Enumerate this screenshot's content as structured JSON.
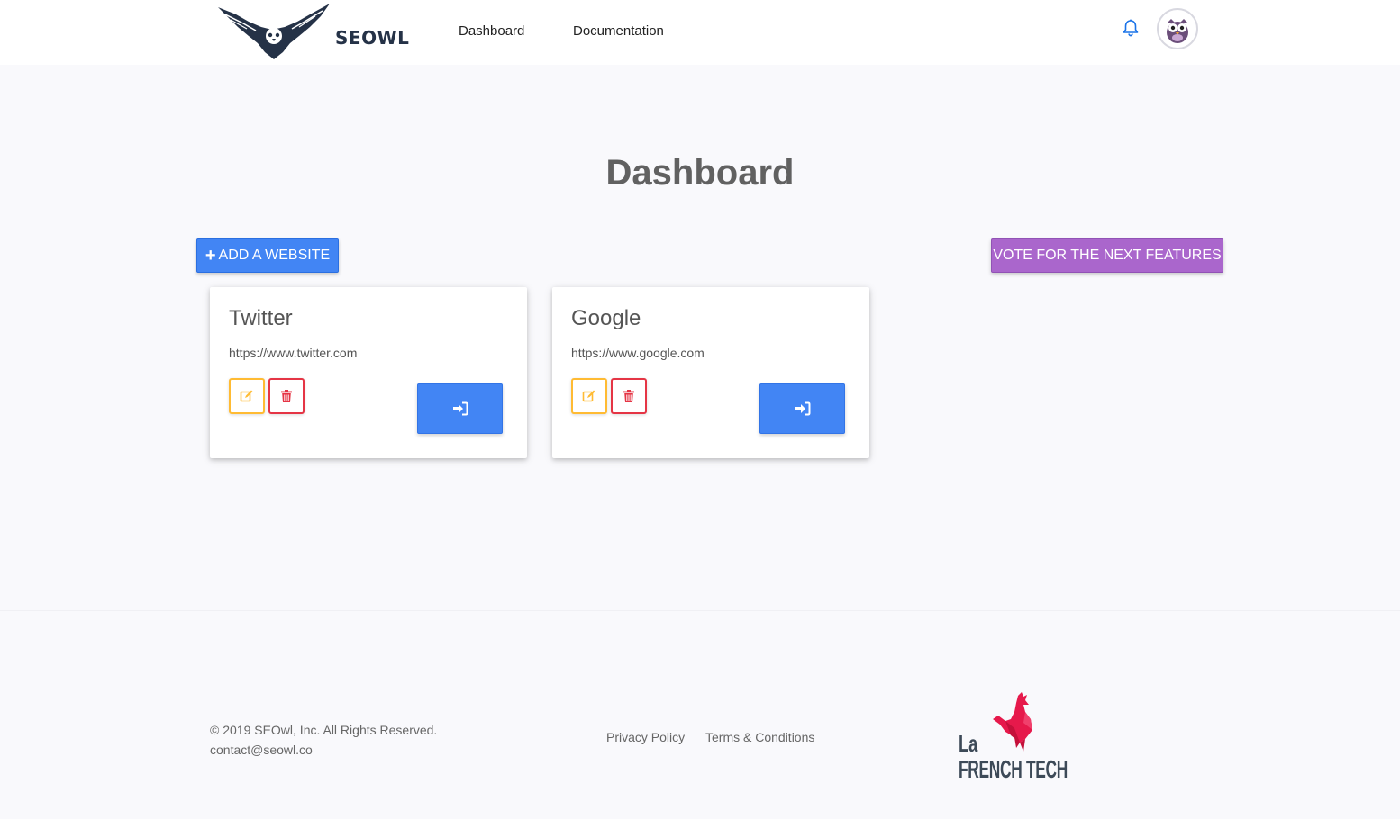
{
  "header": {
    "brand": "SEOWL",
    "nav": [
      {
        "label": "Dashboard"
      },
      {
        "label": "Documentation"
      }
    ],
    "icons": {
      "notifications": "bell-icon",
      "profile": "owl-avatar"
    }
  },
  "main": {
    "title": "Dashboard",
    "add_button": {
      "icon": "plus-icon",
      "label": "ADD A WEBSITE"
    },
    "vote_button": {
      "label": "VOTE FOR THE NEXT FEATURES"
    },
    "websites": [
      {
        "name": "Twitter",
        "url": "https://www.twitter.com",
        "actions": [
          "edit-icon",
          "trash-icon",
          "sign-in-icon"
        ]
      },
      {
        "name": "Google",
        "url": "https://www.google.com",
        "actions": [
          "edit-icon",
          "trash-icon",
          "sign-in-icon"
        ]
      }
    ]
  },
  "footer": {
    "copyright": "© 2019 SEOwl, Inc. All Rights Reserved.",
    "email": "contact@seowl.co",
    "links": [
      {
        "label": "Privacy Policy"
      },
      {
        "label": "Terms & Conditions"
      }
    ],
    "badge": {
      "line1": "La",
      "line2": "FRENCH TECH"
    }
  },
  "colors": {
    "primary": "#4285f4",
    "secondary": "#aa66cc",
    "warning": "#ffbb33",
    "danger": "#e53545",
    "brand_dark": "#253247",
    "frenchtech_red": "#e6194b"
  }
}
